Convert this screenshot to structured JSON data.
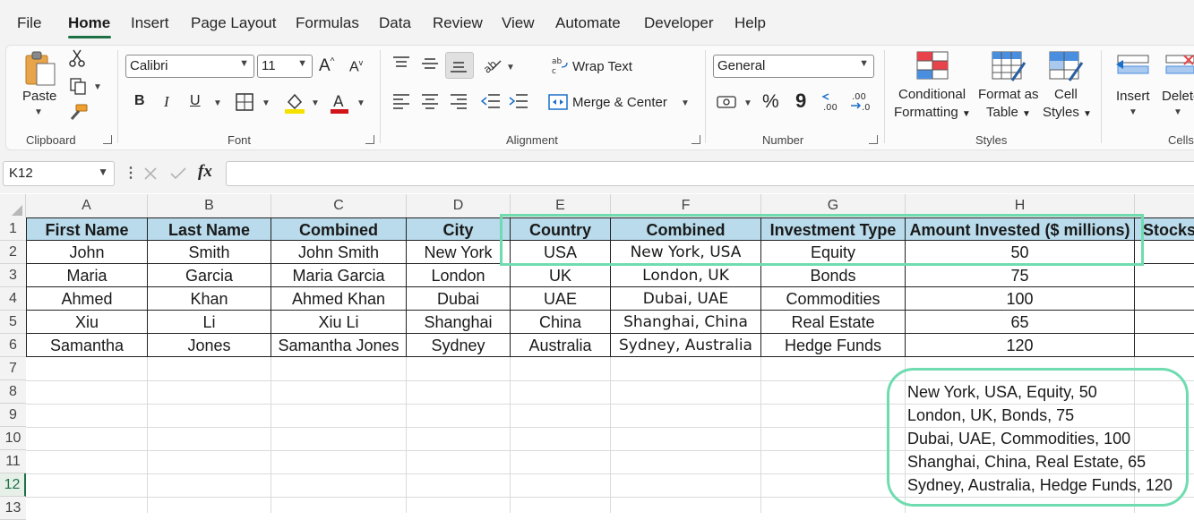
{
  "menu": {
    "items": [
      "File",
      "Home",
      "Insert",
      "Page Layout",
      "Formulas",
      "Data",
      "Review",
      "View",
      "Automate",
      "Developer",
      "Help"
    ],
    "active": "Home",
    "accent_color": "#1e7145"
  },
  "ribbon": {
    "clipboard": {
      "paste_label": "Paste",
      "group_label": "Clipboard"
    },
    "font": {
      "font_name": "Calibri",
      "font_size": "11",
      "bold": "B",
      "italic": "I",
      "underline": "U",
      "group_label": "Font"
    },
    "alignment": {
      "wrap_text": "Wrap Text",
      "merge_center": "Merge & Center",
      "group_label": "Alignment"
    },
    "number": {
      "format": "General",
      "percent": "%",
      "comma": "9",
      "group_label": "Number"
    },
    "styles": {
      "conditional_1": "Conditional",
      "conditional_2": "Formatting",
      "format_table_1": "Format as",
      "format_table_2": "Table",
      "cell_styles_1": "Cell",
      "cell_styles_2": "Styles",
      "group_label": "Styles"
    },
    "cells": {
      "insert": "Insert",
      "delete": "Delete",
      "group_label": "Cells"
    }
  },
  "formula_bar": {
    "name_box": "K12",
    "fx": "fx",
    "formula": ""
  },
  "grid": {
    "columns": [
      "A",
      "B",
      "C",
      "D",
      "E",
      "F",
      "G",
      "H"
    ],
    "rows": [
      "1",
      "2",
      "3",
      "4",
      "5",
      "6",
      "7",
      "8",
      "9",
      "10",
      "11",
      "12",
      "13"
    ],
    "active_row": "12",
    "header_fill": "#b9dbeb",
    "headers": [
      "First Name",
      "Last Name",
      "Combined",
      "City",
      "Country",
      "Combined",
      "Investment Type",
      "Amount Invested ($ millions)",
      "Stocks"
    ],
    "data": [
      [
        "John",
        "Smith",
        "John Smith",
        "New York",
        "USA",
        "New York, USA",
        "Equity",
        "50"
      ],
      [
        "Maria",
        "Garcia",
        "Maria Garcia",
        "London",
        "UK",
        "London, UK",
        "Bonds",
        "75"
      ],
      [
        "Ahmed",
        "Khan",
        "Ahmed Khan",
        "Dubai",
        "UAE",
        "Dubai, UAE",
        "Commodities",
        "100"
      ],
      [
        "Xiu",
        "Li",
        "Xiu Li",
        "Shanghai",
        "China",
        "Shanghai, China",
        "Real Estate",
        "65"
      ],
      [
        "Samantha",
        "Jones",
        "Samantha Jones",
        "Sydney",
        "Australia",
        "Sydney, Australia",
        "Hedge Funds",
        "120"
      ]
    ],
    "results": [
      "New York, USA, Equity, 50",
      "London, UK, Bonds, 75",
      "Dubai, UAE, Commodities, 100",
      "Shanghai, China, Real Estate, 65",
      "Sydney, Australia, Hedge Funds, 120"
    ],
    "highlight_color": "#6fdcb0"
  }
}
